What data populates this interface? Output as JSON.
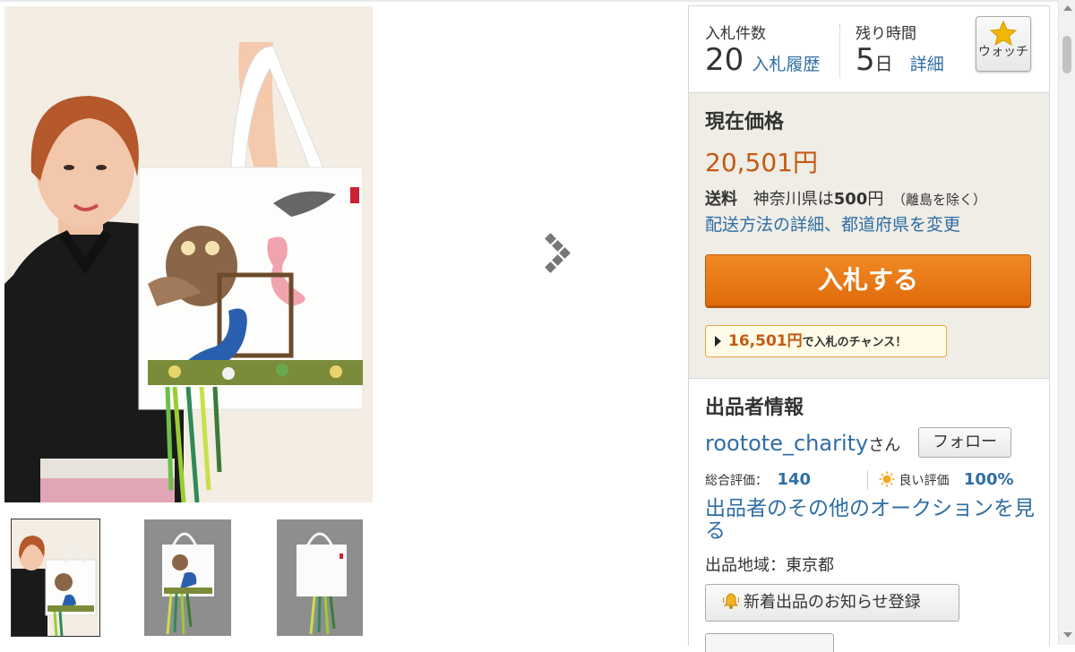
{
  "stats": {
    "bids_label": "入札件数",
    "bids_count": "20",
    "bid_history_link": "入札履歴",
    "time_label": "残り時間",
    "time_value": "5",
    "time_unit": "日",
    "detail_link": "詳細",
    "watch_label": "ウォッチ"
  },
  "price": {
    "title": "現在価格",
    "current": "20,501円",
    "shipping_label": "送料",
    "shipping_region": "神奈川県は",
    "shipping_amount": "500",
    "shipping_yen": "円",
    "shipping_note": "（離島を除く）",
    "shipping_link": "配送方法の詳細、都道府県を変更",
    "bid_button": "入札する",
    "chance_amount": "16,501円",
    "chance_text": "で入札のチャンス！"
  },
  "seller": {
    "title": "出品者情報",
    "name": "rootote_charity",
    "honorific": "さん",
    "follow_button": "フォロー",
    "total_rating_label": "総合評価：",
    "total_rating": "140",
    "good_rating_label": "良い評価",
    "good_rating": "100%",
    "other_auctions_link": "出品者のその他のオークションを見る",
    "region": "出品地域：東京都",
    "notify_button": "新着出品のお知らせ登録"
  },
  "colors": {
    "link": "#2f6ea5",
    "price": "#c55a11",
    "bid_button": "#e8720f",
    "price_box_bg": "#efede6"
  },
  "icons": {
    "watch": "star-icon",
    "good_rating": "sun-icon",
    "notify": "bell-icon",
    "gallery_next": "chevron-right-icon"
  }
}
